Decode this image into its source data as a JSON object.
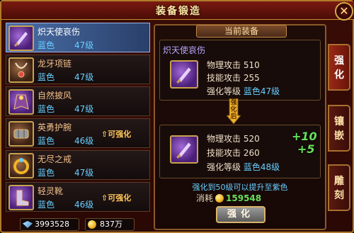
{
  "window": {
    "title": "装备锻造"
  },
  "items": [
    {
      "name": "炽天使哀伤",
      "quality": "蓝色",
      "level": "47级",
      "tag": ""
    },
    {
      "name": "龙牙项链",
      "quality": "蓝色",
      "level": "47级",
      "tag": ""
    },
    {
      "name": "自然披风",
      "quality": "蓝色",
      "level": "47级",
      "tag": ""
    },
    {
      "name": "英勇护腕",
      "quality": "蓝色",
      "level": "46级",
      "tag": "可强化"
    },
    {
      "name": "无尽之戒",
      "quality": "蓝色",
      "level": "47级",
      "tag": ""
    },
    {
      "name": "轻灵靴",
      "quality": "蓝色",
      "level": "46级",
      "tag": "可强化"
    }
  ],
  "currency": {
    "diamonds": "3993528",
    "gold": "837万"
  },
  "panel": {
    "title": "当前装备",
    "current": {
      "name": "炽天使哀伤",
      "phys_label": "物理攻击",
      "phys_value": "510",
      "skill_label": "技能攻击",
      "skill_value": "255",
      "level_label": "强化等级",
      "level_value": "蓝色47级"
    },
    "arrow_text": "强化后",
    "upgraded": {
      "phys_label": "物理攻击",
      "phys_value": "520",
      "skill_label": "技能攻击",
      "skill_value": "260",
      "level_label": "强化等级",
      "level_value": "蓝色48级",
      "phys_plus": "+10",
      "skill_plus": "+5"
    },
    "note": "强化到50级可以提升至紫色",
    "cost_label": "消耗",
    "cost_amount": "159548",
    "button": "强化"
  },
  "tabs": [
    {
      "label": "强化"
    },
    {
      "label": "镶嵌"
    },
    {
      "label": "雕刻"
    }
  ],
  "colors": {
    "quality_blue": "#66cfff",
    "plus_green": "#66e05a",
    "tag_gold": "#ffc75a"
  }
}
